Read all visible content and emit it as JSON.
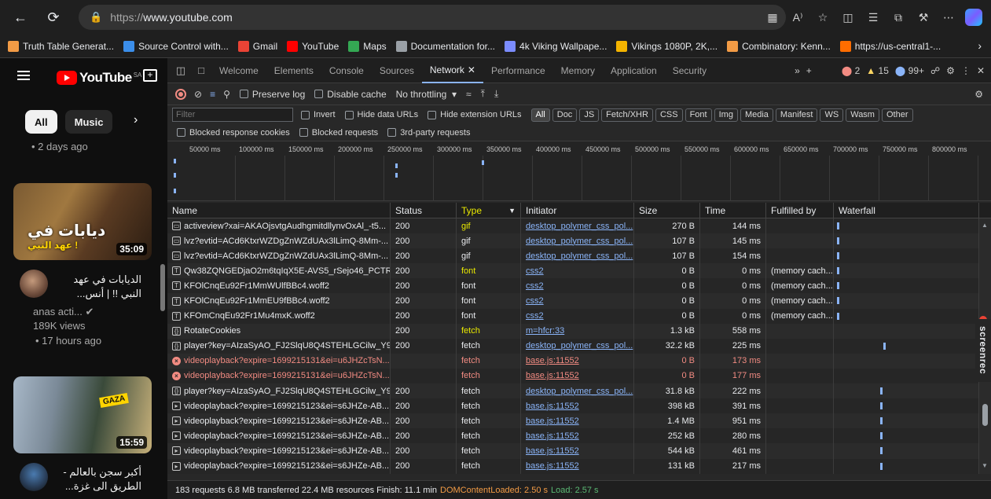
{
  "browser": {
    "url_prefix": "https://",
    "url_host": "www.youtube.com",
    "bookmarks": [
      {
        "label": "Truth Table Generat...",
        "color": "#f29b45"
      },
      {
        "label": "Source Control with...",
        "color": "#3b8eea"
      },
      {
        "label": "Gmail",
        "color": "#ea4335"
      },
      {
        "label": "YouTube",
        "color": "#ff0000"
      },
      {
        "label": "Maps",
        "color": "#34a853"
      },
      {
        "label": "Documentation for...",
        "color": "#9aa0a6"
      },
      {
        "label": "4k Viking Wallpape...",
        "color": "#7b8cff"
      },
      {
        "label": "Vikings 1080P, 2K,...",
        "color": "#f4b400"
      },
      {
        "label": "Combinatory: Kenn...",
        "color": "#f29b45"
      },
      {
        "label": "https://us-central1-...",
        "color": "#ff6d00"
      }
    ]
  },
  "youtube": {
    "logo_text": "YouTube",
    "country": "SA",
    "chips": [
      "All",
      "Music"
    ],
    "meta_top": "• 2 days ago",
    "video1": {
      "thumb_title": "ديابات في",
      "thumb_sub": "عهد النبي !",
      "duration": "35:09",
      "title_line1": "الديابات في عهد",
      "title_line2": "النبي !! | أنس...",
      "channel": "anas acti...",
      "views": "189K views",
      "age": "• 17 hours ago"
    },
    "video2": {
      "badge": "GAZA",
      "duration": "15:59",
      "title_line1": "أكبر سجن بالعالم -",
      "title_line2": "الطريق الى غزة..."
    }
  },
  "devtools": {
    "tabs": [
      "Welcome",
      "Elements",
      "Console",
      "Sources",
      "Network",
      "Performance",
      "Memory",
      "Application",
      "Security"
    ],
    "active_tab": "Network",
    "badges": {
      "errors": "2",
      "warnings": "15",
      "info": "99+"
    },
    "toolbar": {
      "preserve_log": "Preserve log",
      "disable_cache": "Disable cache",
      "throttling": "No throttling"
    },
    "filter_placeholder": "Filter",
    "filter_opts": [
      "Invert",
      "Hide data URLs",
      "Hide extension URLs"
    ],
    "type_chips": [
      "All",
      "Doc",
      "JS",
      "Fetch/XHR",
      "CSS",
      "Font",
      "Img",
      "Media",
      "Manifest",
      "WS",
      "Wasm",
      "Other"
    ],
    "extra_opts": [
      "Blocked response cookies",
      "Blocked requests",
      "3rd-party requests"
    ],
    "timeline_labels": [
      "50000 ms",
      "100000 ms",
      "150000 ms",
      "200000 ms",
      "250000 ms",
      "300000 ms",
      "350000 ms",
      "400000 ms",
      "450000 ms",
      "500000 ms",
      "550000 ms",
      "600000 ms",
      "650000 ms",
      "700000 ms",
      "750000 ms",
      "800000 ms"
    ],
    "columns": [
      "Name",
      "Status",
      "Type",
      "Initiator",
      "Size",
      "Time",
      "Fulfilled by",
      "Waterfall"
    ],
    "rows": [
      {
        "icon": "doc",
        "name": "activeview?xai=AKAOjsvtgAudhgmitdllynvOxAl_-t5...",
        "status": "200",
        "type": "gif",
        "type_hl": true,
        "initiator": "desktop_polymer_css_pol...",
        "size": "270 B",
        "time": "144 ms",
        "fulfilled": "",
        "error": false,
        "wf": 0.02
      },
      {
        "icon": "doc",
        "name": "lvz?evtid=ACd6KtxrWZDgZnWZdUAx3lLimQ-8Mm-...",
        "status": "200",
        "type": "gif",
        "type_hl": false,
        "initiator": "desktop_polymer_css_pol...",
        "size": "107 B",
        "time": "145 ms",
        "fulfilled": "",
        "error": false,
        "wf": 0.02
      },
      {
        "icon": "doc",
        "name": "lvz?evtid=ACd6KtxrWZDgZnWZdUAx3lLimQ-8Mm-...",
        "status": "200",
        "type": "gif",
        "type_hl": false,
        "initiator": "desktop_polymer_css_pol...",
        "size": "107 B",
        "time": "154 ms",
        "fulfilled": "",
        "error": false,
        "wf": 0.02
      },
      {
        "icon": "font",
        "name": "Qw38ZQNGEDjaO2m6tqIqX5E-AVS5_rSejo46_PCTR...",
        "status": "200",
        "type": "font",
        "type_hl": true,
        "initiator": "css2",
        "size": "0 B",
        "time": "0 ms",
        "fulfilled": "(memory cach...",
        "error": false,
        "wf": 0.02
      },
      {
        "icon": "font",
        "name": "KFOlCnqEu92Fr1MmWUlfBBc4.woff2",
        "status": "200",
        "type": "font",
        "type_hl": false,
        "initiator": "css2",
        "size": "0 B",
        "time": "0 ms",
        "fulfilled": "(memory cach...",
        "error": false,
        "wf": 0.02
      },
      {
        "icon": "font",
        "name": "KFOlCnqEu92Fr1MmEU9fBBc4.woff2",
        "status": "200",
        "type": "font",
        "type_hl": false,
        "initiator": "css2",
        "size": "0 B",
        "time": "0 ms",
        "fulfilled": "(memory cach...",
        "error": false,
        "wf": 0.02
      },
      {
        "icon": "font",
        "name": "KFOmCnqEu92Fr1Mu4mxK.woff2",
        "status": "200",
        "type": "font",
        "type_hl": false,
        "initiator": "css2",
        "size": "0 B",
        "time": "0 ms",
        "fulfilled": "(memory cach...",
        "error": false,
        "wf": 0.02
      },
      {
        "icon": "xhr",
        "name": "RotateCookies",
        "status": "200",
        "type": "fetch",
        "type_hl": true,
        "initiator": "m=hfcr:33",
        "size": "1.3 kB",
        "time": "558 ms",
        "fulfilled": "",
        "error": false,
        "wf": -1
      },
      {
        "icon": "xhr",
        "name": "player?key=AIzaSyAO_FJ2SlqU8Q4STEHLGCilw_Y9_...",
        "status": "200",
        "type": "fetch",
        "type_hl": false,
        "initiator": "desktop_polymer_css_pol...",
        "size": "32.2 kB",
        "time": "225 ms",
        "fulfilled": "",
        "error": false,
        "wf": 0.34
      },
      {
        "icon": "err",
        "name": "videoplayback?expire=1699215131&ei=u6JHZcTsN...",
        "status": "",
        "type": "fetch",
        "type_hl": false,
        "initiator": "base.js:11552",
        "size": "0 B",
        "time": "173 ms",
        "fulfilled": "",
        "error": true,
        "wf": -1
      },
      {
        "icon": "err",
        "name": "videoplayback?expire=1699215131&ei=u6JHZcTsN...",
        "status": "",
        "type": "fetch",
        "type_hl": false,
        "initiator": "base.js:11552",
        "size": "0 B",
        "time": "177 ms",
        "fulfilled": "",
        "error": true,
        "wf": -1
      },
      {
        "icon": "xhr",
        "name": "player?key=AIzaSyAO_FJ2SlqU8Q4STEHLGCilw_Y9_...",
        "status": "200",
        "type": "fetch",
        "type_hl": false,
        "initiator": "desktop_polymer_css_pol...",
        "size": "31.8 kB",
        "time": "222 ms",
        "fulfilled": "",
        "error": false,
        "wf": 0.32
      },
      {
        "icon": "media",
        "name": "videoplayback?expire=1699215123&ei=s6JHZe-AB...",
        "status": "200",
        "type": "fetch",
        "type_hl": false,
        "initiator": "base.js:11552",
        "size": "398 kB",
        "time": "391 ms",
        "fulfilled": "",
        "error": false,
        "wf": 0.32
      },
      {
        "icon": "media",
        "name": "videoplayback?expire=1699215123&ei=s6JHZe-AB...",
        "status": "200",
        "type": "fetch",
        "type_hl": false,
        "initiator": "base.js:11552",
        "size": "1.4 MB",
        "time": "951 ms",
        "fulfilled": "",
        "error": false,
        "wf": 0.32
      },
      {
        "icon": "media",
        "name": "videoplayback?expire=1699215123&ei=s6JHZe-AB...",
        "status": "200",
        "type": "fetch",
        "type_hl": false,
        "initiator": "base.js:11552",
        "size": "252 kB",
        "time": "280 ms",
        "fulfilled": "",
        "error": false,
        "wf": 0.32
      },
      {
        "icon": "media",
        "name": "videoplayback?expire=1699215123&ei=s6JHZe-AB...",
        "status": "200",
        "type": "fetch",
        "type_hl": false,
        "initiator": "base.js:11552",
        "size": "544 kB",
        "time": "461 ms",
        "fulfilled": "",
        "error": false,
        "wf": 0.32
      },
      {
        "icon": "media",
        "name": "videoplayback?expire=1699215123&ei=s6JHZe-AB...",
        "status": "200",
        "type": "fetch",
        "type_hl": false,
        "initiator": "base.js:11552",
        "size": "131 kB",
        "time": "217 ms",
        "fulfilled": "",
        "error": false,
        "wf": 0.32
      }
    ],
    "status_bar": {
      "main": "183 requests  6.8 MB transferred  22.4 MB resources  Finish: 11.1 min",
      "dcl": "DOMContentLoaded: 2.50 s",
      "load": "Load: 2.57 s"
    }
  },
  "overlay": {
    "screenrec": "screenrec"
  }
}
